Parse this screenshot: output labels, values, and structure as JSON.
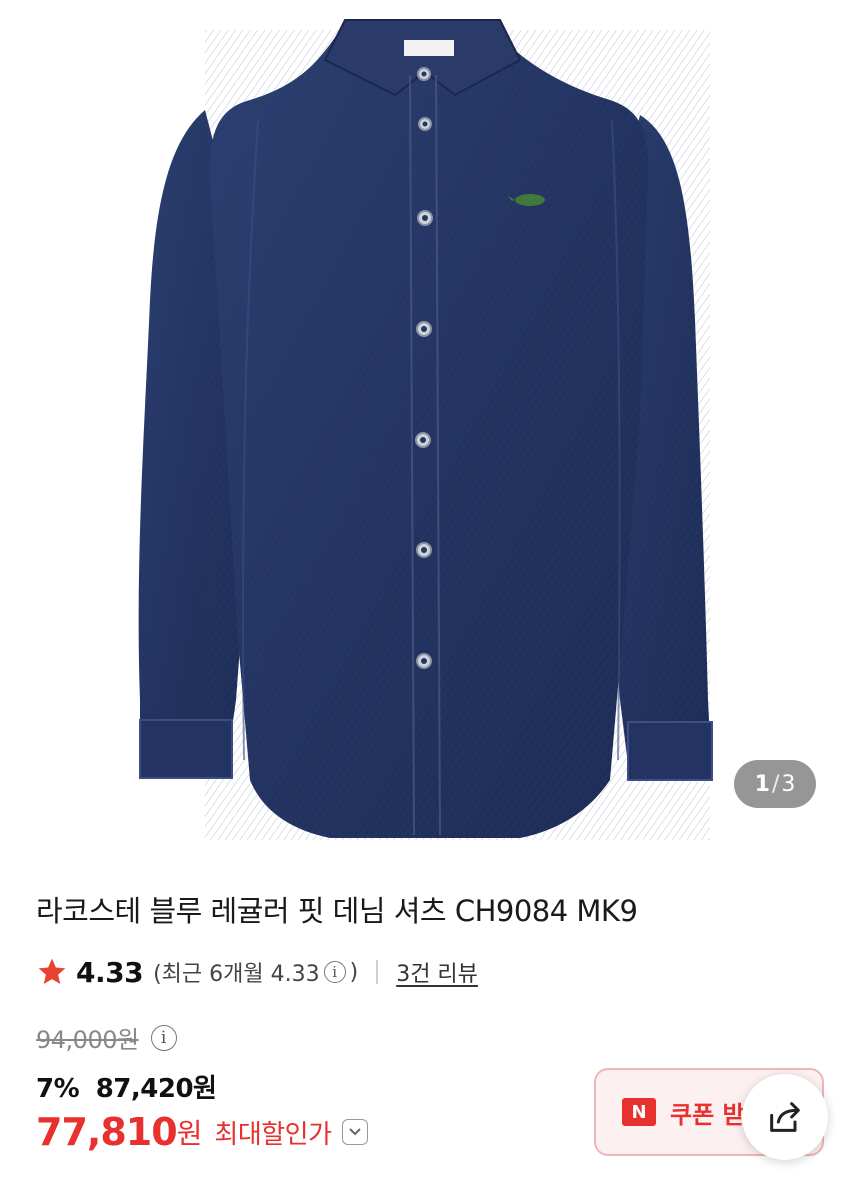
{
  "product": {
    "title": "라코스테 블루 레귤러 핏 데님 셔츠 CH9084 MK9",
    "image_icon": "denim-shirt-image",
    "gallery": {
      "current": "1",
      "separator": "/",
      "total": "3"
    }
  },
  "rating": {
    "score": "4.33",
    "recent_text": "(최근 6개월 4.33",
    "recent_close": ")",
    "info_glyph": "i",
    "reviews_link": "3건 리뷰"
  },
  "price": {
    "original": "94,000원",
    "info_glyph": "i",
    "discount_percent": "7%",
    "discount_price": "87,420원",
    "final_amount": "77,810",
    "final_unit": "원",
    "max_discount_label": "최대할인가"
  },
  "coupon": {
    "badge": "N",
    "label": "쿠폰 받"
  },
  "colors": {
    "accent_red": "#e8302f",
    "coupon_bg": "#fdf0f0",
    "denim": "#253765",
    "star": "#e8432f"
  }
}
